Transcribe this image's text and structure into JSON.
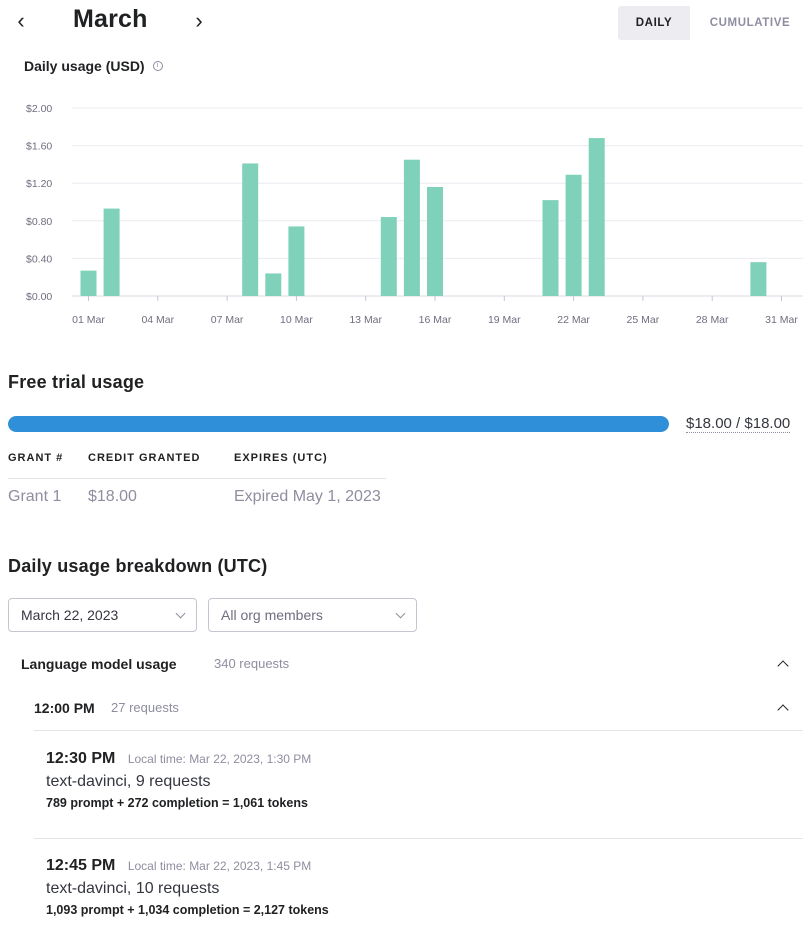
{
  "header": {
    "prev_icon": "‹",
    "next_icon": "›",
    "month": "March",
    "toggle": {
      "daily": "DAILY",
      "cumulative": "CUMULATIVE",
      "active": "daily"
    }
  },
  "chart_title": "Daily usage (USD)",
  "chart_data": {
    "type": "bar",
    "ylabel": "",
    "xlabel": "",
    "ylim": [
      0,
      2.0
    ],
    "y_ticks": [
      "$0.00",
      "$0.40",
      "$0.80",
      "$1.20",
      "$1.60",
      "$2.00"
    ],
    "x_tick_labels": [
      "01 Mar",
      "04 Mar",
      "07 Mar",
      "10 Mar",
      "13 Mar",
      "16 Mar",
      "19 Mar",
      "22 Mar",
      "25 Mar",
      "28 Mar",
      "31 Mar"
    ],
    "bar_color": "#7fd1b9",
    "days": [
      1,
      2,
      3,
      4,
      5,
      6,
      7,
      8,
      9,
      10,
      11,
      12,
      13,
      14,
      15,
      16,
      17,
      18,
      19,
      20,
      21,
      22,
      23,
      24,
      25,
      26,
      27,
      28,
      29,
      30,
      31
    ],
    "values": [
      0.27,
      0.93,
      0,
      0,
      0,
      0,
      0,
      1.41,
      0.24,
      0.74,
      0,
      0,
      0,
      0.84,
      1.45,
      1.16,
      0,
      0,
      0,
      0,
      1.02,
      1.29,
      1.68,
      0,
      0,
      0,
      0,
      0,
      0,
      0.36,
      0
    ],
    "grid": true
  },
  "free_trial": {
    "title": "Free trial usage",
    "used": 18.0,
    "total": 18.0,
    "progress_fraction": 1.0,
    "label": "$18.00 / $18.00",
    "bar_color": "#2f8fd8",
    "table": {
      "headers": [
        "GRANT #",
        "CREDIT GRANTED",
        "EXPIRES (UTC)"
      ],
      "rows": [
        [
          "Grant 1",
          "$18.00",
          "Expired May 1, 2023"
        ]
      ]
    }
  },
  "breakdown": {
    "title": "Daily usage breakdown (UTC)",
    "date_select": "March 22, 2023",
    "members_select": "All org members",
    "language_model": {
      "label": "Language model usage",
      "count": "340 requests"
    },
    "hour_group": {
      "label": "12:00 PM",
      "count": "27 requests"
    },
    "entries": [
      {
        "time": "12:30 PM",
        "local": "Local time: Mar 22, 2023, 1:30 PM",
        "model": "text-davinci, 9 requests",
        "tokens": "789 prompt + 272 completion = 1,061 tokens"
      },
      {
        "time": "12:45 PM",
        "local": "Local time: Mar 22, 2023, 1:45 PM",
        "model": "text-davinci, 10 requests",
        "tokens": "1,093 prompt + 1,034 completion = 2,127 tokens"
      }
    ]
  }
}
